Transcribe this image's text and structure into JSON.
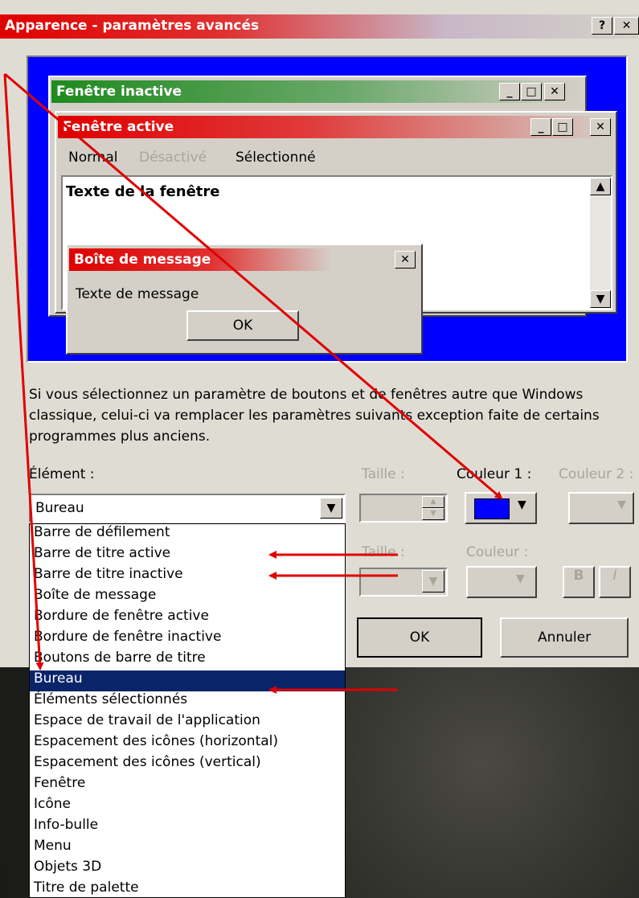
{
  "window": {
    "title": "Apparence - paramètres avancés",
    "help_btn": "?",
    "close_btn": "✕"
  },
  "preview": {
    "inactive_title": "Fenêtre inactive",
    "active_title": "Fenêtre active",
    "menu": {
      "normal": "Normal",
      "disabled": "Désactivé",
      "selected": "Sélectionné"
    },
    "window_text": "Texte de la fenêtre",
    "msgbox": {
      "title": "Boîte de message",
      "text": "Texte de message",
      "ok": "OK"
    }
  },
  "description": "Si vous sélectionnez un paramètre de boutons et de fenêtres autre que Windows classique, celui-ci va remplacer les paramètres suivants exception faite de certains programmes plus anciens.",
  "labels": {
    "element": "Élément :",
    "size1": "Taille :",
    "color1": "Couleur 1 :",
    "color2": "Couleur 2 :",
    "size2": "Taille :",
    "color": "Couleur :"
  },
  "element_select": {
    "value": "Bureau"
  },
  "buttons": {
    "ok": "OK",
    "cancel": "Annuler",
    "bold": "B",
    "italic": "I"
  },
  "colors": {
    "desktop_blue": "#0000ff",
    "selection": "#0a246a",
    "title_red": "#e00000",
    "title_green": "#2a8a2a",
    "arrow": "#e00000"
  },
  "list_items": [
    "Barre de défilement",
    "Barre de titre active",
    "Barre de titre inactive",
    "Boîte de message",
    "Bordure de fenêtre active",
    "Bordure de fenêtre inactive",
    "Boutons de barre de titre",
    "Bureau",
    "Éléments sélectionnés",
    "Espace de travail de l'application",
    "Espacement des icônes (horizontal)",
    "Espacement des icônes (vertical)",
    "Fenêtre",
    "Icône",
    "Info-bulle",
    "Menu",
    "Objets 3D",
    "Titre de palette"
  ]
}
